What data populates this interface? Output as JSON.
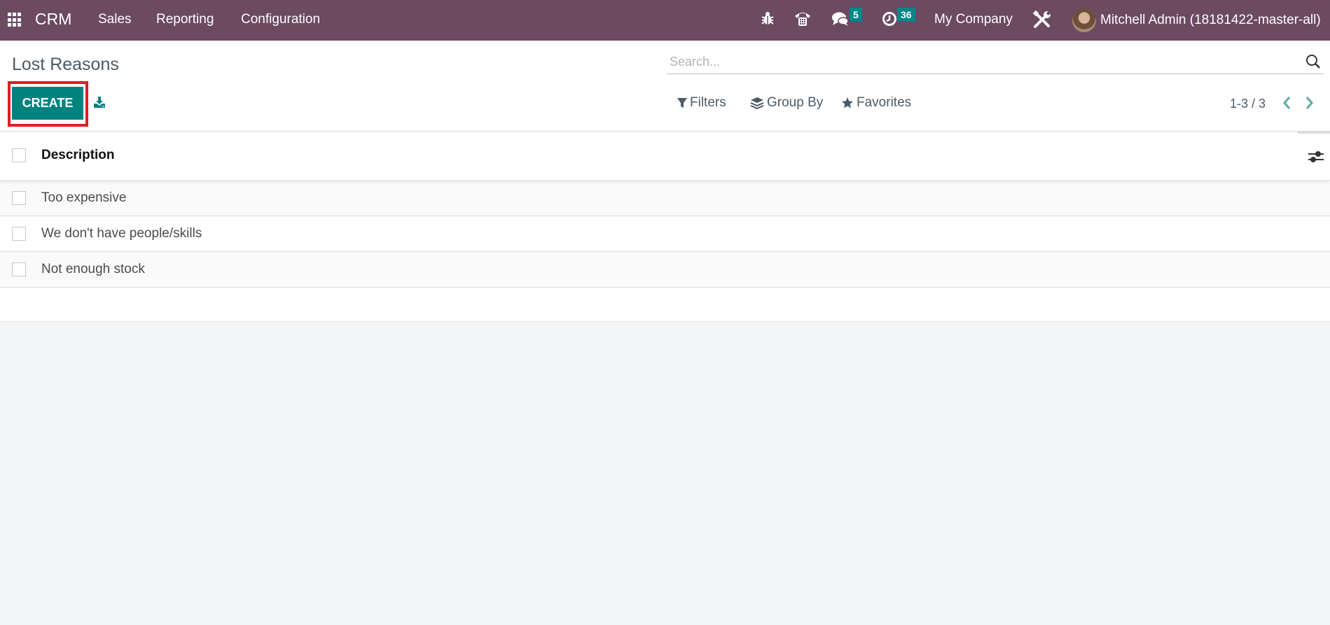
{
  "navbar": {
    "brand": "CRM",
    "menu": [
      "Sales",
      "Reporting",
      "Configuration"
    ],
    "messages_count": "5",
    "activities_count": "36",
    "company": "My Company",
    "user": "Mitchell Admin (18181422-master-all)",
    "icons": [
      "apps-grid-icon",
      "bug-icon",
      "phone-icon",
      "chat-icon",
      "clock-icon",
      "tools-icon"
    ]
  },
  "control_panel": {
    "title": "Lost Reasons",
    "create_label": "CREATE",
    "search_placeholder": "Search...",
    "filters_label": "Filters",
    "group_by_label": "Group By",
    "favorites_label": "Favorites",
    "pager": "1-3 / 3"
  },
  "list": {
    "columns": [
      "Description"
    ],
    "rows": [
      {
        "description": "Too expensive"
      },
      {
        "description": "We don't have people/skills"
      },
      {
        "description": "Not enough stock"
      }
    ]
  },
  "colors": {
    "navbar": "#6b4a62",
    "primary": "#00827f",
    "badge": "#00878a",
    "highlight": "#e21b23"
  }
}
